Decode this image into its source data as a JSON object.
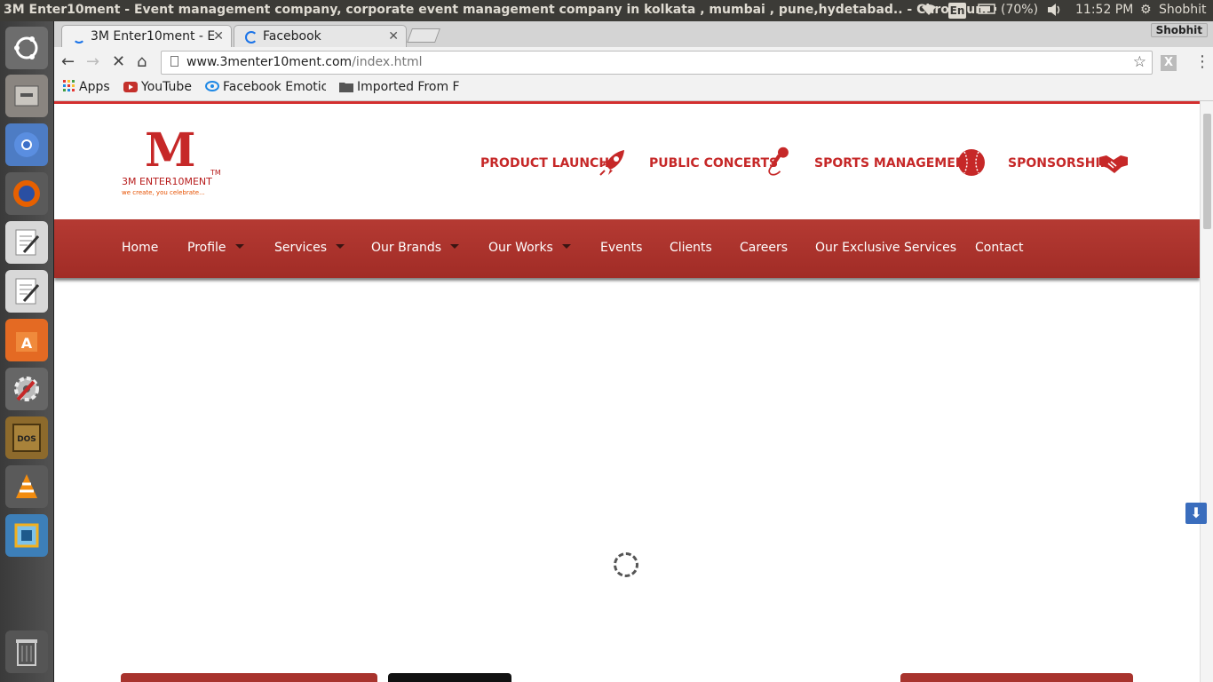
{
  "top_panel": {
    "window_title": "3M Enter10ment - Event management company, corporate event management company in kolkata , mumbai , pune,hydetabad.. - Chromium",
    "keyboard": "En",
    "battery": "(70%)",
    "time": "11:52 PM",
    "user": "Shobhit"
  },
  "tabs": [
    {
      "label": "3M Enter10ment - E"
    },
    {
      "label": "Facebook"
    }
  ],
  "profile_badge": "Shobhit",
  "address_bar": {
    "host": "www.3menter10ment.com",
    "path": "/index.html"
  },
  "bookmarks": [
    {
      "label": "Apps"
    },
    {
      "label": "YouTube"
    },
    {
      "label": "Facebook Emotic"
    },
    {
      "label": "Imported From F"
    }
  ],
  "site": {
    "logo": {
      "mark": "M",
      "name": "3M ENTER10MENT",
      "tm": "TM",
      "tagline": "we create, you celebrate..."
    },
    "header_links": [
      {
        "label": "PRODUCT LAUNCH",
        "icon": "rocket-icon"
      },
      {
        "label": "PUBLIC CONCERTS",
        "icon": "microphone-icon"
      },
      {
        "label": "SPORTS MANAGEMENT",
        "icon": "baseball-icon"
      },
      {
        "label": "SPONSORSHIP",
        "icon": "handshake-icon"
      }
    ],
    "nav": [
      {
        "label": "Home"
      },
      {
        "label": "Profile"
      },
      {
        "label": "Services"
      },
      {
        "label": "Our Brands"
      },
      {
        "label": "Our Works"
      },
      {
        "label": "Events"
      },
      {
        "label": "Clients"
      },
      {
        "label": "Careers"
      },
      {
        "label": "Our Exclusive Services"
      },
      {
        "label": "Contact"
      }
    ]
  },
  "colors": {
    "brand_red": "#c62828",
    "nav_bg": "#a12c26",
    "ubuntu_panel": "#3c3b37"
  }
}
